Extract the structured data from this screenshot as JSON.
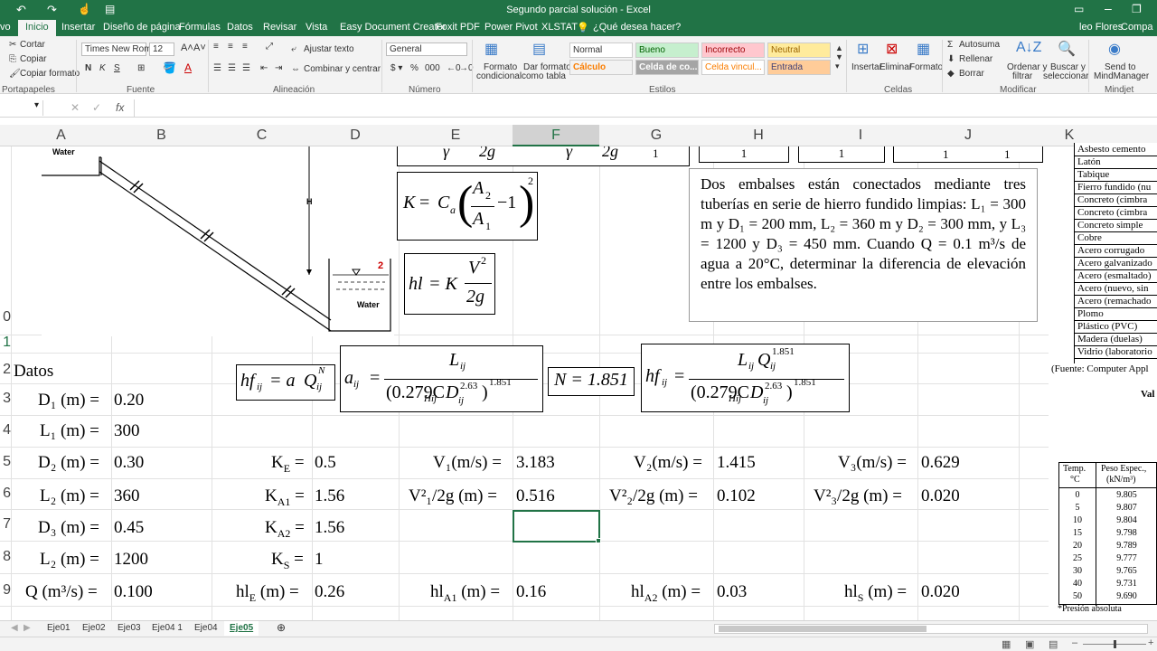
{
  "title": "Segundo parcial solución - Excel",
  "tabs": [
    "Archivo",
    "Inicio",
    "Insertar",
    "Diseño de página",
    "Fórmulas",
    "Datos",
    "Revisar",
    "Vista",
    "Easy Document Creator",
    "Foxit PDF",
    "Power Pivot",
    "XLSTAT"
  ],
  "tab_labels": {
    "file": "vo",
    "home": "Inicio",
    "insert": "Insertar",
    "layout": "Diseño de página",
    "formulas": "Fórmulas",
    "data": "Datos",
    "review": "Revisar",
    "view": "Vista",
    "edc": "Easy Document Creator",
    "foxit": "Foxit PDF",
    "pivot": "Power Pivot",
    "xlstat": "XLSTAT"
  },
  "tellme": "¿Qué desea hacer?",
  "user": "leo Flores",
  "share": "Compa",
  "ribbon": {
    "cut": "Cortar",
    "copy": "Copiar",
    "format_painter": "Copiar formato",
    "clipboard": "Portapapeles",
    "font_name": "Times New Roma",
    "font_size": "12",
    "font_group": "Fuente",
    "wrap": "Ajustar texto",
    "merge": "Combinar y centrar",
    "alignment": "Alineación",
    "number_format": "General",
    "number": "Número",
    "cond1": "Formato",
    "cond2": "condicional",
    "table1": "Dar formato",
    "table2": "como tabla",
    "styles": {
      "normal": "Normal",
      "good": "Bueno",
      "bad": "Incorrecto",
      "neutral": "Neutral",
      "calc": "Cálculo",
      "check": "Celda de co...",
      "linked": "Celda vincul...",
      "input": "Entrada"
    },
    "styles_group": "Estilos",
    "insert": "Insertar",
    "delete": "Eliminar",
    "format": "Formato",
    "cells": "Celdas",
    "autosum": "Autosuma",
    "fill": "Rellenar",
    "clear": "Borrar",
    "sort1": "Ordenar y",
    "sort2": "filtrar",
    "find1": "Buscar y",
    "find2": "seleccionar",
    "modify": "Modificar",
    "mind1": "Send to",
    "mind2": "MindManager",
    "mindjet": "Mindjet"
  },
  "fx": "fx",
  "columns": [
    "A",
    "B",
    "C",
    "D",
    "E",
    "F",
    "G",
    "H",
    "I",
    "J",
    "K"
  ],
  "rows": [
    "0",
    "1",
    "2",
    "3",
    "4",
    "5",
    "6",
    "7",
    "8",
    "9"
  ],
  "diagram": {
    "water1": "Water",
    "water2": "Water",
    "h": "H",
    "n2": "2"
  },
  "top_eq": {
    "g1": "γ",
    "g2": "2g",
    "g3": "γ",
    "g4": "2g",
    "one": "1",
    "h": "1",
    "i": "1",
    "j1": "1",
    "j2": "1"
  },
  "eq_k": {
    "k": "K",
    "eq": "=",
    "c": "C",
    "a": "a",
    "a2": "A",
    "s2": "2",
    "a1": "A",
    "s1": "1",
    "m": "−1",
    "p": "2"
  },
  "eq_hl": {
    "hl": "hl",
    "eq": "= K",
    "v": "V",
    "p": "2",
    "g": "2g"
  },
  "eq_hf": {
    "hf": "hf",
    "ij": "ij",
    "eq": "= a",
    "q": "Q",
    "n": "N"
  },
  "eq_a": {
    "a": "a",
    "ij": "ij",
    "eq": "=",
    "l": "L",
    "den": "(0.279C",
    "hij": "Hij",
    "d": "D",
    "e": "2.63",
    "close": ")",
    "exp": "1.851"
  },
  "eq_n": {
    "n": "N = 1.851"
  },
  "eq_hf2": {
    "hf": "hf",
    "ij": "ij",
    "eq": "=",
    "l": "L",
    "q": "Q",
    "exp": "1.851",
    "den": "(0.279C",
    "hij": "Hij",
    "d": "D",
    "e": "2.63",
    "close": ")",
    "exp2": "1.851"
  },
  "problem": "Dos embalses están conectados mediante tres tuberías en serie de hierro fundido limpias: L₁ = 300 m y D₁ = 200 mm, L₂ = 360 m y D₂ = 300 mm, y L₃ = 1200 y D₃ = 450 mm. Cuando Q = 0.1 m³/s de agua a 20°C, determinar la diferencia de elevación entre los embalses.",
  "cells": {
    "datos": "Datos",
    "d1": "D₁ (m) =",
    "d1v": "0.20",
    "l1": "L₁ (m) =",
    "l1v": "300",
    "d2": "D₂ (m) =",
    "d2v": "0.30",
    "l2": "L₂ (m) =",
    "l2v": "360",
    "d3": "D₃ (m) =",
    "d3v": "0.45",
    "l3": "L₂ (m) =",
    "l3v": "1200",
    "q": "Q (m³/s) =",
    "qv": "0.100",
    "ke": "K",
    "ke_s": "E",
    "ke_eq": "=",
    "kev": "0.5",
    "ka1": "K",
    "ka1_s": "A1",
    "ka1_eq": "=",
    "ka1v": "1.56",
    "ka2": "K",
    "ka2_s": "A2",
    "ka2_eq": "=",
    "ka2v": "1.56",
    "ks": "K",
    "ks_s": "S",
    "ks_eq": "=",
    "ksv": "1",
    "hle": "hl",
    "hle_s": "E",
    "hle_eq": "(m) =",
    "hlev": "0.26",
    "v1": "V₁(m/s) =",
    "v1v": "3.183",
    "v1g": "V²₁/2g (m) =",
    "v1gv": "0.516",
    "hla1": "hl",
    "hla1_s": "A1",
    "hla1_eq": "(m) =",
    "hla1v": "0.16",
    "v2": "V₂(m/s) =",
    "v2v": "1.415",
    "v2g": "V²₂/2g (m) =",
    "v2gv": "0.102",
    "hla2": "hl",
    "hla2_s": "A2",
    "hla2_eq": "(m) =",
    "hla2v": "0.03",
    "v3": "V₃(m/s) =",
    "v3v": "0.629",
    "v3g": "V²₃/2g (m) =",
    "v3gv": "0.020",
    "hls": "hl",
    "hls_s": "S",
    "hls_eq": "(m) =",
    "hlsv": "0.020"
  },
  "materials": [
    "Asbesto cemento",
    "Latón",
    "Tabique",
    "Fierro fundido (nu",
    "Concreto (cimbra",
    "Concreto (cimbra",
    "Concreto simple",
    "Cobre",
    "Acero corrugado",
    "Acero galvanizado",
    "Acero (esmaltado)",
    "Acero (nuevo, sin",
    "Acero (remachado",
    "Plomo",
    "Plástico (PVC)",
    "Madera (duelas)",
    "Vidrio (laboratorio"
  ],
  "source": "(Fuente: Computer Appl",
  "val": "Val",
  "temp_table": {
    "h1": "Temp.",
    "h1b": "°C",
    "h2": "Peso Espec.,",
    "h2b": "(kN/m³)",
    "rows": [
      [
        "0",
        "9.805"
      ],
      [
        "5",
        "9.807"
      ],
      [
        "10",
        "9.804"
      ],
      [
        "15",
        "9.798"
      ],
      [
        "20",
        "9.789"
      ],
      [
        "25",
        "9.777"
      ],
      [
        "30",
        "9.765"
      ],
      [
        "40",
        "9.731"
      ],
      [
        "50",
        "9.690"
      ]
    ],
    "note": "*Presión absoluta"
  },
  "sheets": [
    "Eje01",
    "Eje02",
    "Eje03",
    "Eje04 1",
    "Eje04",
    "Eje05"
  ],
  "colors": {
    "excel_green": "#217346",
    "ribbon_bg": "#f3f3f3"
  }
}
